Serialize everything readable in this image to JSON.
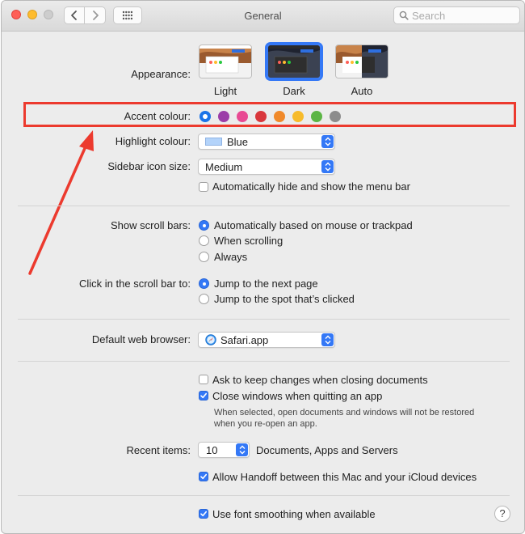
{
  "window": {
    "title": "General"
  },
  "search": {
    "placeholder": "Search"
  },
  "appearance": {
    "label": "Appearance:",
    "options": [
      {
        "name": "Light",
        "selected": false
      },
      {
        "name": "Dark",
        "selected": true
      },
      {
        "name": "Auto",
        "selected": false
      }
    ]
  },
  "accent": {
    "label": "Accent colour:",
    "colors": [
      "#1a73e8",
      "#9b3ea8",
      "#e84a93",
      "#d9373c",
      "#f0892a",
      "#f7bb2b",
      "#5cb545",
      "#8c8c8c"
    ],
    "selected_index": 0
  },
  "highlight": {
    "label": "Highlight colour:",
    "value": "Blue",
    "swatch": "#b3d3fa"
  },
  "sidebar_icon": {
    "label": "Sidebar icon size:",
    "value": "Medium"
  },
  "menu_bar": {
    "label": "Automatically hide and show the menu bar",
    "checked": false
  },
  "scroll_bars": {
    "label": "Show scroll bars:",
    "options": [
      "Automatically based on mouse or trackpad",
      "When scrolling",
      "Always"
    ],
    "selected_index": 0
  },
  "click_scroll": {
    "label": "Click in the scroll bar to:",
    "options": [
      "Jump to the next page",
      "Jump to the spot that’s clicked"
    ],
    "selected_index": 0
  },
  "browser": {
    "label": "Default web browser:",
    "value": "Safari.app"
  },
  "ask_keep": {
    "label": "Ask to keep changes when closing documents",
    "checked": false
  },
  "close_windows": {
    "label": "Close windows when quitting an app",
    "checked": true,
    "note_line1": "When selected, open documents and windows will not be restored",
    "note_line2": "when you re-open an app."
  },
  "recent": {
    "label": "Recent items:",
    "value": "10",
    "suffix": "Documents, Apps and Servers"
  },
  "handoff": {
    "label": "Allow Handoff between this Mac and your iCloud devices",
    "checked": true
  },
  "font_smoothing": {
    "label": "Use font smoothing when available",
    "checked": true
  },
  "help": {
    "label": "?"
  },
  "colors": {
    "accent_blue": "#3478f6",
    "callout_red": "#ec3a2e"
  }
}
